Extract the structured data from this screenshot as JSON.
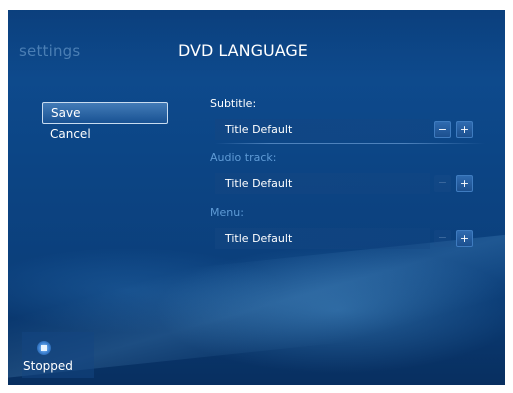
{
  "header": {
    "section": "settings",
    "title": "DVD LANGUAGE"
  },
  "actions": {
    "save_label": "Save",
    "cancel_label": "Cancel"
  },
  "options": [
    {
      "label": "Subtitle:",
      "value": "Title Default",
      "decrement": "−",
      "increment": "+"
    },
    {
      "label": "Audio track:",
      "value": "Title Default",
      "decrement": "−",
      "increment": "+"
    },
    {
      "label": "Menu:",
      "value": "Title Default",
      "decrement": "−",
      "increment": "+"
    }
  ],
  "playback": {
    "status": "Stopped",
    "icon": "stop-icon"
  },
  "colors": {
    "background": "#0c4585",
    "accent_dim": "#5f9bd6",
    "text": "#ffffff"
  }
}
